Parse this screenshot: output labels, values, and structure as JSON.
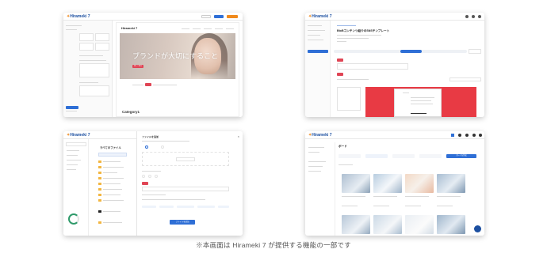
{
  "caption": "※本画面は Hirameki 7 が提供する機能の一部です",
  "brand": {
    "logo_text": "Hirameki 7",
    "logo_star": "✦"
  },
  "colors": {
    "primary": "#2f6fd6",
    "brand_navy": "#1c4fa0",
    "accent_orange": "#f08a1c",
    "cta_red": "#e04555"
  },
  "screen1": {
    "site_logo": "Hirameki 7",
    "hero_title": "ブランドが大切にすること",
    "hero_button": "詳しく見る",
    "category_heading": "Category1"
  },
  "screen2": {
    "page_title": "BtoBコンテンツ紹介のSNSテンプレート"
  },
  "screen3": {
    "folder_header": "すべてのファイル",
    "panel_title": "ファイルを追加",
    "submit_button": "ファイルを追加"
  },
  "screen4": {
    "board_title": "ボード",
    "create_button": "ボードを作成"
  }
}
